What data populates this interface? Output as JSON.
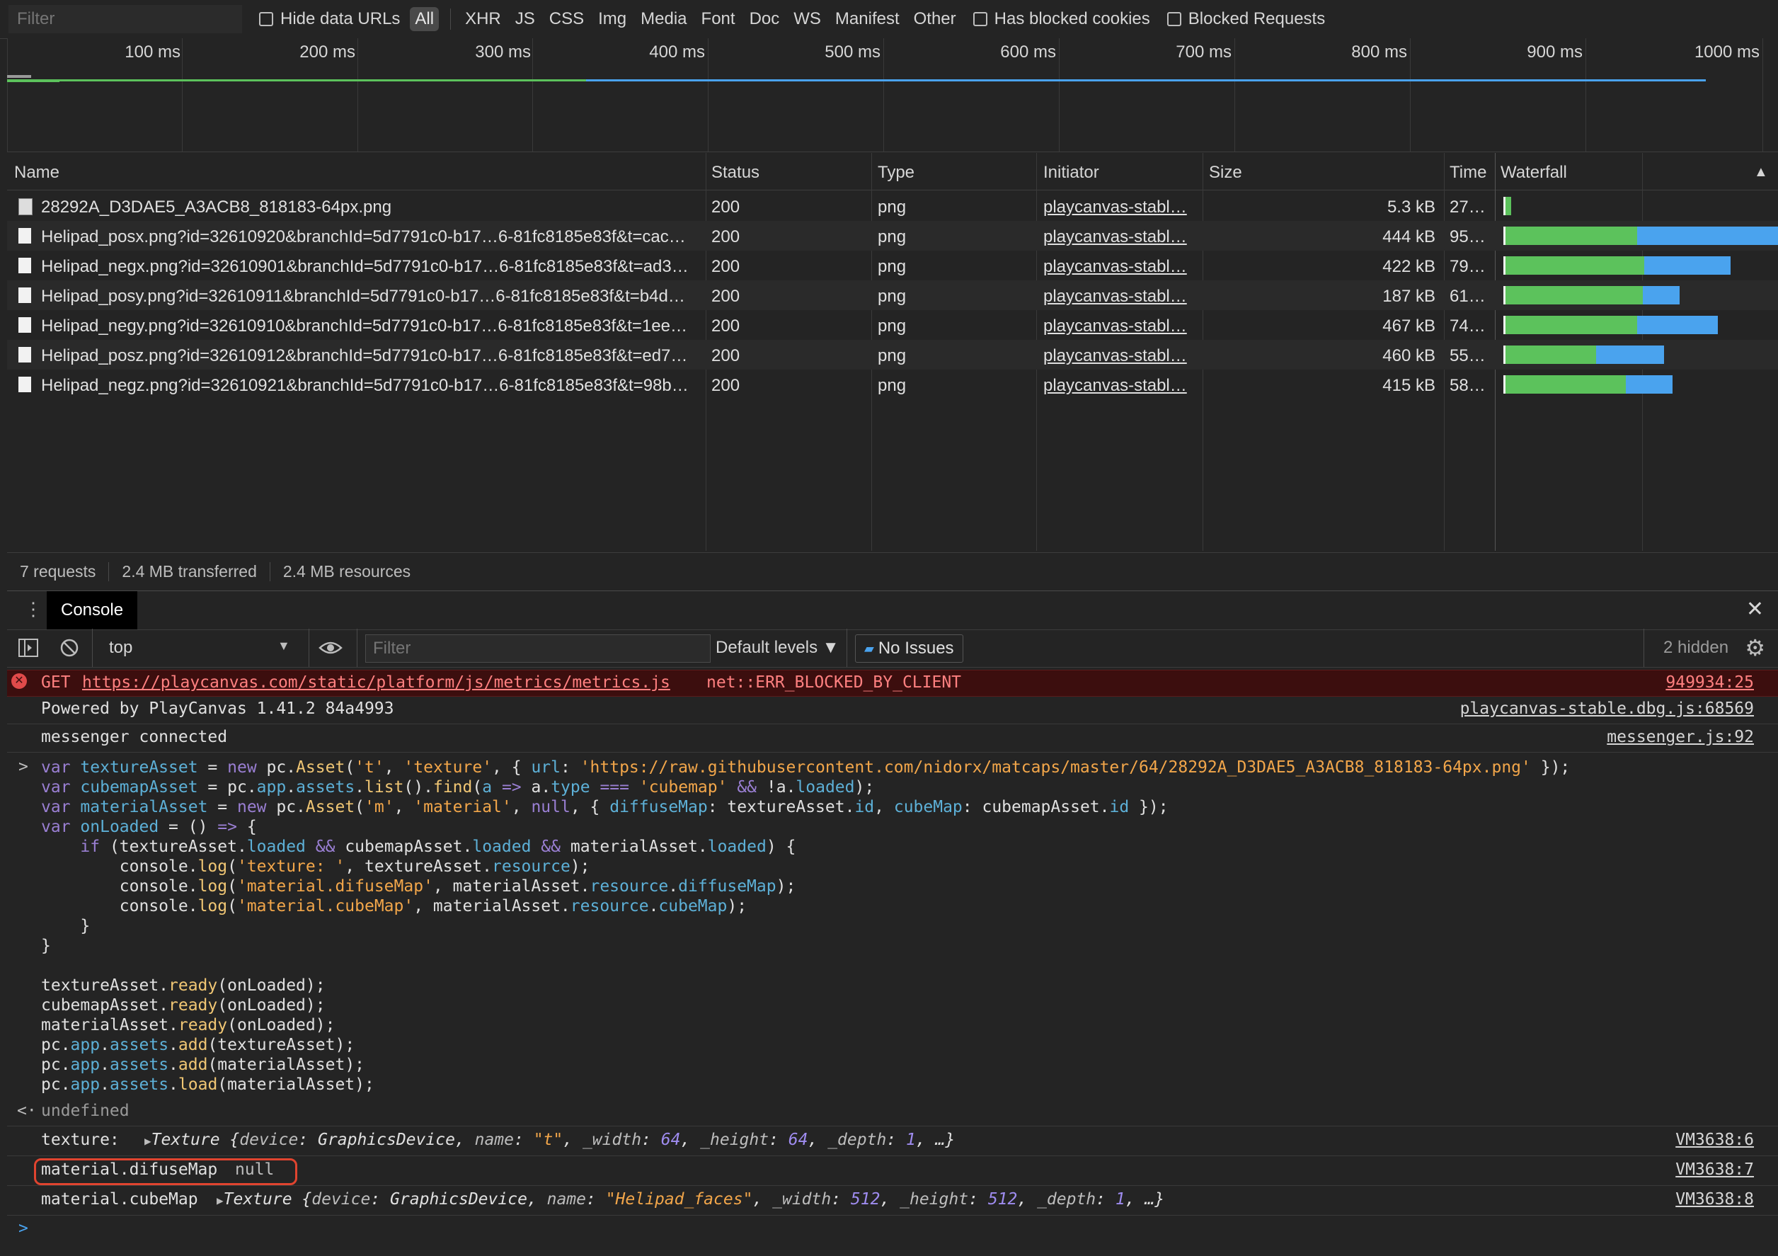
{
  "filter_bar": {
    "filter_placeholder": "Filter",
    "hide_data_urls": "Hide data URLs",
    "types": [
      "All",
      "XHR",
      "JS",
      "CSS",
      "Img",
      "Media",
      "Font",
      "Doc",
      "WS",
      "Manifest",
      "Other"
    ],
    "has_blocked_cookies": "Has blocked cookies",
    "blocked_requests": "Blocked Requests"
  },
  "overview": {
    "ticks": [
      "100 ms",
      "200 ms",
      "300 ms",
      "400 ms",
      "500 ms",
      "600 ms",
      "700 ms",
      "800 ms",
      "900 ms",
      "1000 ms"
    ]
  },
  "table": {
    "headers": {
      "name": "Name",
      "status": "Status",
      "type": "Type",
      "initiator": "Initiator",
      "size": "Size",
      "time": "Time",
      "waterfall": "Waterfall"
    },
    "rows": [
      {
        "name": "28292A_D3DAE5_A3ACB8_818183-64px.png",
        "status": "200",
        "type": "png",
        "initiator": "playcanvas-stabl…",
        "size": "5.3 kB",
        "time": "27…"
      },
      {
        "name": "Helipad_posx.png?id=32610920&branchId=5d7791c0-b17…6-81fc8185e83f&t=cac…",
        "status": "200",
        "type": "png",
        "initiator": "playcanvas-stabl…",
        "size": "444 kB",
        "time": "95…"
      },
      {
        "name": "Helipad_negx.png?id=32610901&branchId=5d7791c0-b17…6-81fc8185e83f&t=ad3…",
        "status": "200",
        "type": "png",
        "initiator": "playcanvas-stabl…",
        "size": "422 kB",
        "time": "79…"
      },
      {
        "name": "Helipad_posy.png?id=32610911&branchId=5d7791c0-b17…6-81fc8185e83f&t=b4d…",
        "status": "200",
        "type": "png",
        "initiator": "playcanvas-stabl…",
        "size": "187 kB",
        "time": "61…"
      },
      {
        "name": "Helipad_negy.png?id=32610910&branchId=5d7791c0-b17…6-81fc8185e83f&t=1ee…",
        "status": "200",
        "type": "png",
        "initiator": "playcanvas-stabl…",
        "size": "467 kB",
        "time": "74…"
      },
      {
        "name": "Helipad_posz.png?id=32610912&branchId=5d7791c0-b17…6-81fc8185e83f&t=ed7…",
        "status": "200",
        "type": "png",
        "initiator": "playcanvas-stabl…",
        "size": "460 kB",
        "time": "55…"
      },
      {
        "name": "Helipad_negz.png?id=32610921&branchId=5d7791c0-b17…6-81fc8185e83f&t=98b…",
        "status": "200",
        "type": "png",
        "initiator": "playcanvas-stabl…",
        "size": "415 kB",
        "time": "58…"
      }
    ]
  },
  "summary": {
    "requests": "7 requests",
    "transferred": "2.4 MB transferred",
    "resources": "2.4 MB resources"
  },
  "drawer": {
    "tab_label": "Console"
  },
  "console_toolbar": {
    "context": "top",
    "filter_placeholder": "Filter",
    "levels": "Default levels ▼",
    "issues": "No Issues",
    "hidden": "2 hidden"
  },
  "console": {
    "error": {
      "method": "GET",
      "url": "https://playcanvas.com/static/platform/js/metrics/metrics.js",
      "code": "net::ERR_BLOCKED_BY_CLIENT",
      "source": "949934:25"
    },
    "log1": {
      "text": "Powered by PlayCanvas 1.41.2 84a4993",
      "source": "playcanvas-stable.dbg.js:68569"
    },
    "log2": {
      "text": "messenger connected",
      "source": "messenger.js:92"
    },
    "result": "undefined",
    "texture_log": {
      "label": "texture: ",
      "source": "VM3638:6"
    },
    "difuse_log": {
      "label": "material.difuseMap",
      "value": "null",
      "source": "VM3638:7"
    },
    "cube_log": {
      "label": "material.cubeMap",
      "source": "VM3638:8"
    }
  }
}
